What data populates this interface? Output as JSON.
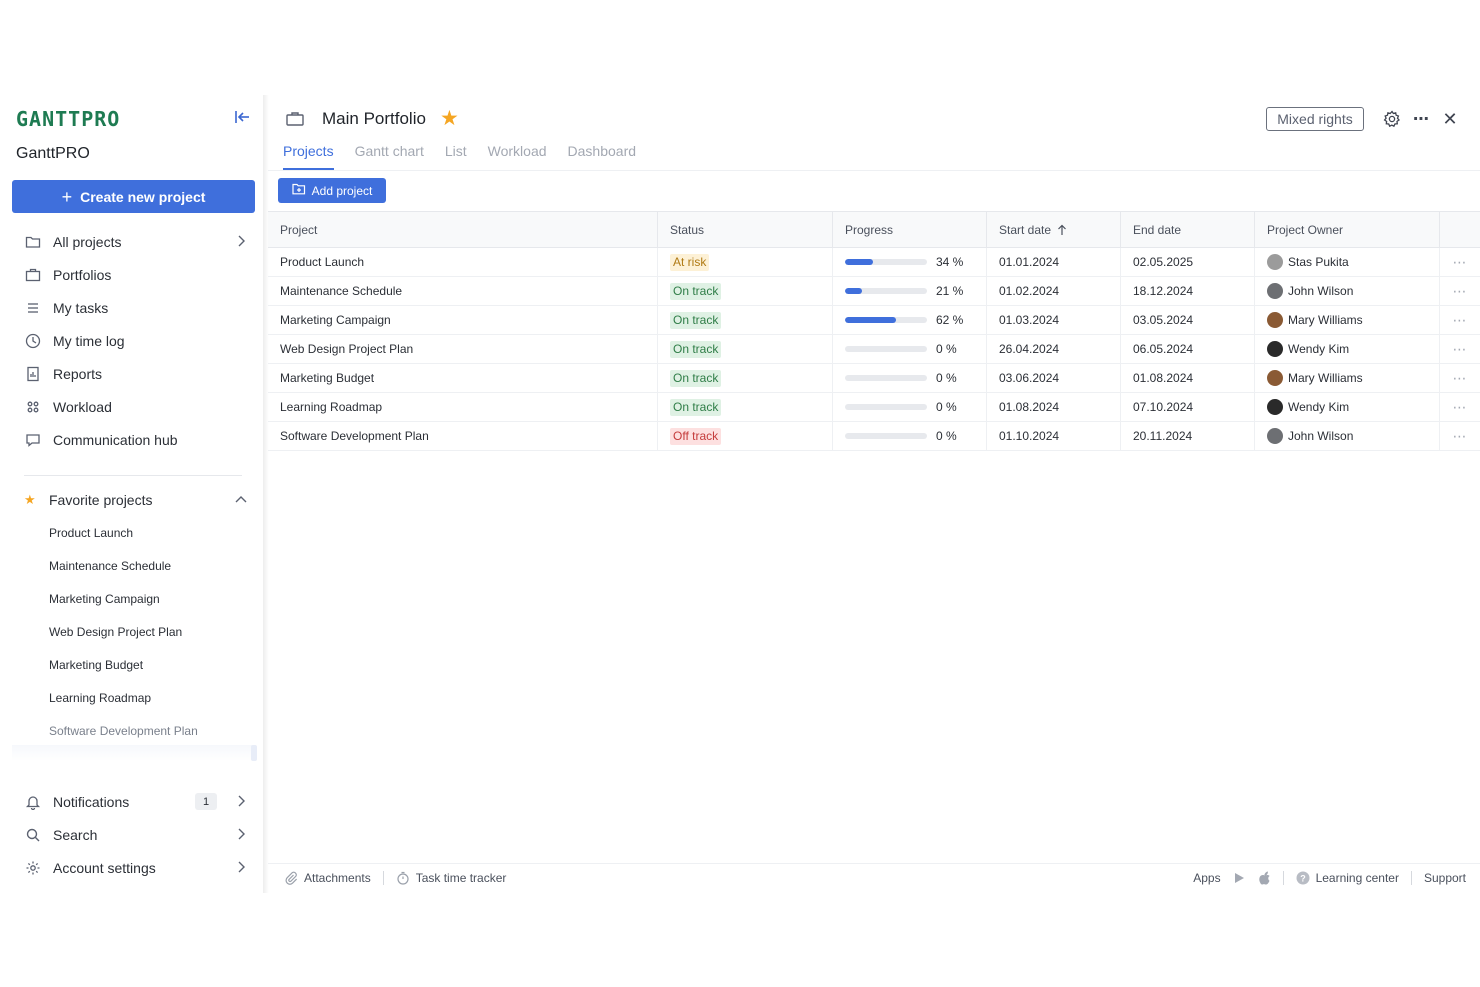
{
  "sidebar": {
    "logo": "GANTTPRO",
    "workspace": "GanttPRO",
    "create_label": "Create new project",
    "nav": [
      {
        "label": "All projects",
        "icon": "folder-icon"
      },
      {
        "label": "Portfolios",
        "icon": "briefcase-icon"
      },
      {
        "label": "My tasks",
        "icon": "list-icon"
      },
      {
        "label": "My time log",
        "icon": "clock-icon"
      },
      {
        "label": "Reports",
        "icon": "report-icon"
      },
      {
        "label": "Workload",
        "icon": "grid-icon"
      },
      {
        "label": "Communication hub",
        "icon": "chat-icon"
      }
    ],
    "favorites_header": "Favorite projects",
    "favorites": [
      "Product Launch",
      "Maintenance Schedule",
      "Marketing Campaign",
      "Web Design Project Plan",
      "Marketing Budget",
      "Learning Roadmap",
      "Software Development Plan"
    ],
    "bottom": [
      {
        "label": "Notifications",
        "badge": "1"
      },
      {
        "label": "Search"
      },
      {
        "label": "Account settings"
      }
    ]
  },
  "header": {
    "title": "Main Portfolio",
    "rights": "Mixed rights",
    "more": "⋯",
    "close": "✕"
  },
  "tabs": [
    "Projects",
    "Gantt chart",
    "List",
    "Workload",
    "Dashboard"
  ],
  "add_project": "Add project",
  "table": {
    "columns": [
      "Project",
      "Status",
      "Progress",
      "Start date",
      "End date",
      "Project Owner"
    ],
    "rows": [
      {
        "project": "Product Launch",
        "status": "At risk",
        "status_kind": "risk",
        "progress": 34,
        "progress_label": "34 %",
        "start": "01.01.2024",
        "end": "02.05.2025",
        "owner": "Stas Pukita",
        "avatar_color": "#9b9b9b"
      },
      {
        "project": "Maintenance Schedule",
        "status": "On track",
        "status_kind": "track",
        "progress": 21,
        "progress_label": "21 %",
        "start": "01.02.2024",
        "end": "18.12.2024",
        "owner": "John Wilson",
        "avatar_color": "#6d6f73"
      },
      {
        "project": "Marketing Campaign",
        "status": "On track",
        "status_kind": "track",
        "progress": 62,
        "progress_label": "62 %",
        "start": "01.03.2024",
        "end": "03.05.2024",
        "owner": "Mary Williams",
        "avatar_color": "#8a5a34"
      },
      {
        "project": "Web Design Project Plan",
        "status": "On track",
        "status_kind": "track",
        "progress": 0,
        "progress_label": "0 %",
        "start": "26.04.2024",
        "end": "06.05.2024",
        "owner": "Wendy Kim",
        "avatar_color": "#2a2a2a"
      },
      {
        "project": "Marketing Budget",
        "status": "On track",
        "status_kind": "track",
        "progress": 0,
        "progress_label": "0 %",
        "start": "03.06.2024",
        "end": "01.08.2024",
        "owner": "Mary Williams",
        "avatar_color": "#8a5a34"
      },
      {
        "project": "Learning Roadmap",
        "status": "On track",
        "status_kind": "track",
        "progress": 0,
        "progress_label": "0 %",
        "start": "01.08.2024",
        "end": "07.10.2024",
        "owner": "Wendy Kim",
        "avatar_color": "#2a2a2a"
      },
      {
        "project": "Software Development Plan",
        "status": "Off track",
        "status_kind": "off",
        "progress": 0,
        "progress_label": "0 %",
        "start": "01.10.2024",
        "end": "20.11.2024",
        "owner": "John Wilson",
        "avatar_color": "#6d6f73"
      }
    ]
  },
  "footer": {
    "attachments": "Attachments",
    "time_tracker": "Task time tracker",
    "apps": "Apps",
    "learning": "Learning center",
    "support": "Support"
  },
  "colors": {
    "accent": "#3f6fdc",
    "brand": "#1e7b52",
    "star": "#f5a623"
  }
}
